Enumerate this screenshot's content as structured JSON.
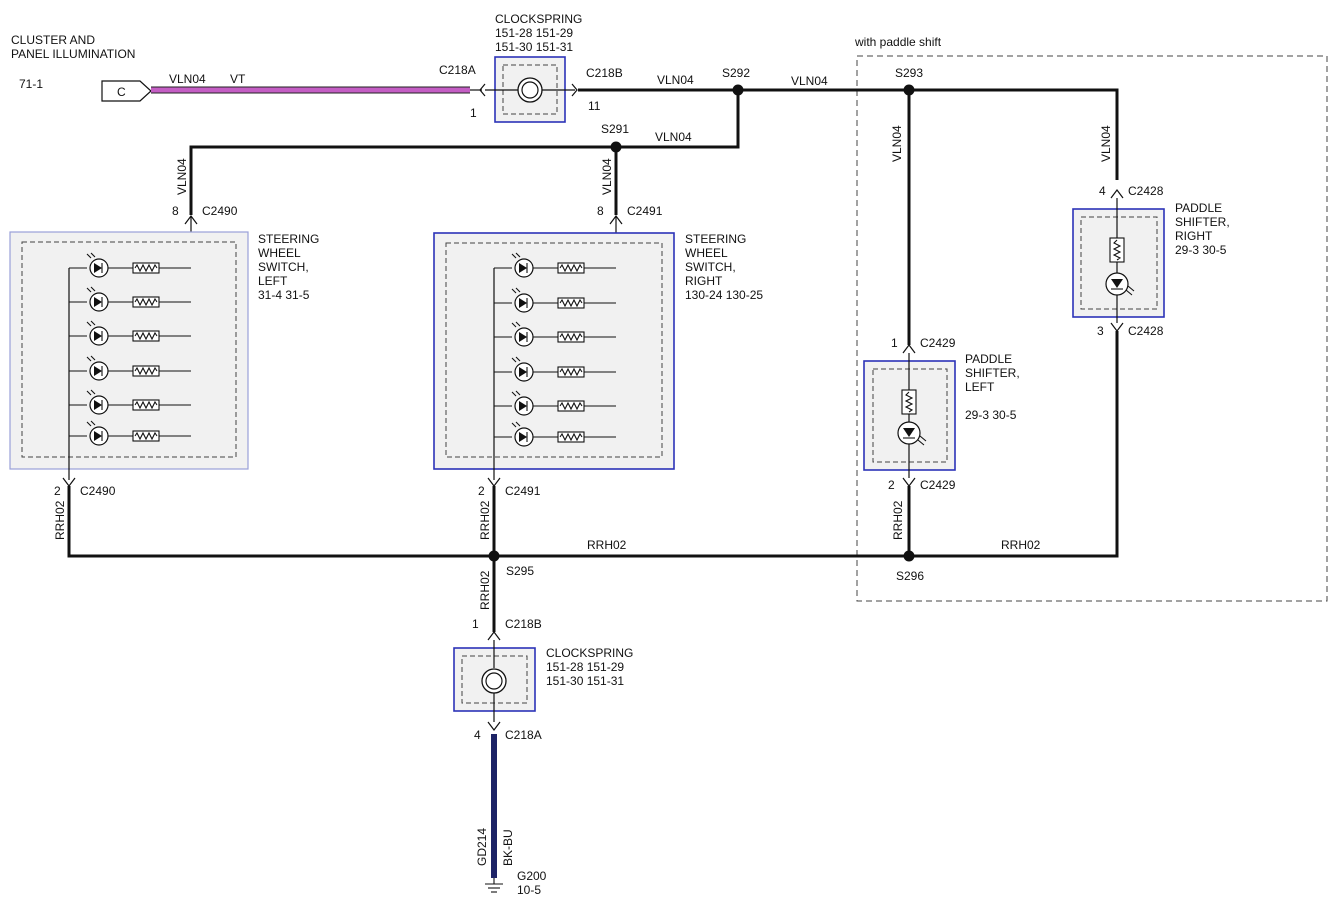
{
  "title": {
    "line1": "CLUSTER AND",
    "line2": "PANEL ILLUMINATION",
    "ref": "71-1",
    "connector_tag": "C"
  },
  "option_label": "with paddle shift",
  "clockspring_top": {
    "name": "CLOCKSPRING",
    "refs1": "151-28  151-29",
    "refs2": "151-30  151-31",
    "left_conn": "C218A",
    "left_pin": "1",
    "right_conn": "C218B",
    "right_pin": "11"
  },
  "clockspring_bottom": {
    "name": "CLOCKSPRING",
    "refs1": "151-28  151-29",
    "refs2": "151-30  151-31",
    "top_conn": "C218B",
    "top_pin": "1",
    "bottom_conn": "C218A",
    "bottom_pin": "4"
  },
  "switch_left": {
    "line1": "STEERING",
    "line2": "WHEEL",
    "line3": "SWITCH,",
    "line4": "LEFT",
    "refs": "31-4    31-5",
    "top_pin": "8",
    "top_conn": "C2490",
    "bottom_pin": "2",
    "bottom_conn": "C2490"
  },
  "switch_right": {
    "line1": "STEERING",
    "line2": "WHEEL",
    "line3": "SWITCH,",
    "line4": "RIGHT",
    "refs": "130-24  130-25",
    "top_pin": "8",
    "top_conn": "C2491",
    "bottom_pin": "2",
    "bottom_conn": "C2491"
  },
  "paddle_left": {
    "line1": "PADDLE",
    "line2": "SHIFTER,",
    "line3": "LEFT",
    "refs": "29-3    30-5",
    "top_pin": "1",
    "top_conn": "C2429",
    "bottom_pin": "2",
    "bottom_conn": "C2429"
  },
  "paddle_right": {
    "line1": "PADDLE",
    "line2": "SHIFTER,",
    "line3": "RIGHT",
    "refs": "29-3    30-5",
    "top_pin": "4",
    "top_conn": "C2428",
    "bottom_pin": "3",
    "bottom_conn": "C2428"
  },
  "wires": {
    "vln04": "VLN04",
    "vt": "VT",
    "rrh02": "RRH02",
    "gd214": "GD214",
    "bkbu": "BK-BU"
  },
  "splices": {
    "s291": "S291",
    "s292": "S292",
    "s293": "S293",
    "s295": "S295",
    "s296": "S296"
  },
  "ground": {
    "name": "G200",
    "ref": "10-5"
  },
  "colors": {
    "component_border": "#2c33b8",
    "vt_wire": "#c45ec4",
    "ground_wire": "#1d2366"
  }
}
